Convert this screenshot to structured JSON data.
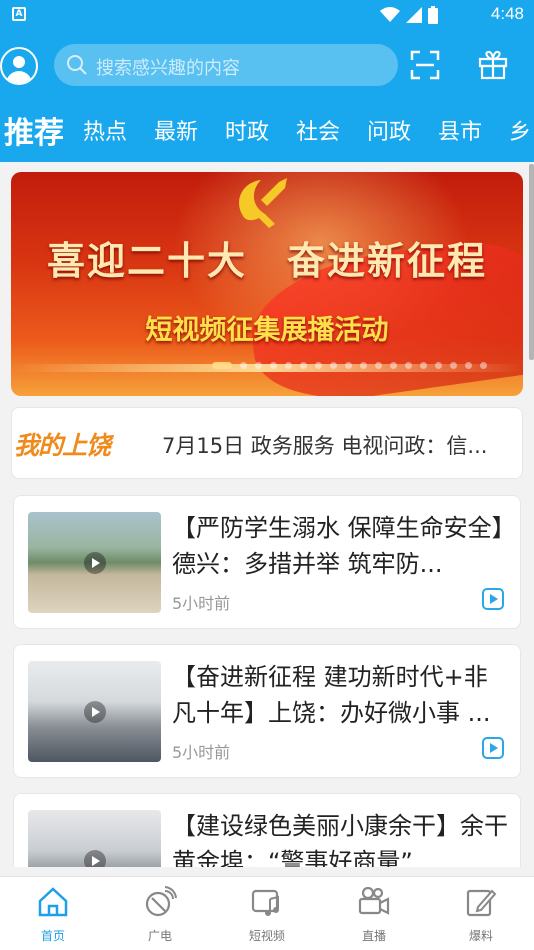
{
  "status_bar": {
    "time": "4:48",
    "notification_icon": "A"
  },
  "header": {
    "search_placeholder": "搜索感兴趣的内容",
    "tabs": [
      {
        "label": "推荐",
        "active": true
      },
      {
        "label": "热点"
      },
      {
        "label": "最新"
      },
      {
        "label": "时政"
      },
      {
        "label": "社会"
      },
      {
        "label": "问政"
      },
      {
        "label": "县市"
      },
      {
        "label": "乡"
      }
    ]
  },
  "banner": {
    "title": "喜迎二十大　奋进新征程",
    "subtitle": "短视频征集展播活动",
    "slide_count": 18,
    "active_slide": 1
  },
  "notice": {
    "logo": "我的上饶",
    "text": "7月15日  政务服务  电视问政：信..."
  },
  "articles": [
    {
      "title": "【严防学生溺水 保障生命安全】德兴：多措并举 筑牢防...",
      "time": "5小时前",
      "type": "video"
    },
    {
      "title": "【奋进新征程 建功新时代+非凡十年】上饶：办好微小事 ...",
      "time": "5小时前",
      "type": "video"
    },
    {
      "title": "【建设绿色美丽小康余干】余干黄金埠：“警事好商量”",
      "time": "",
      "type": "video"
    }
  ],
  "bottom_nav": [
    {
      "label": "首页",
      "icon": "home-icon",
      "active": true
    },
    {
      "label": "广电",
      "icon": "satellite-icon"
    },
    {
      "label": "短视频",
      "icon": "music-video-icon"
    },
    {
      "label": "直播",
      "icon": "camera-icon"
    },
    {
      "label": "爆料",
      "icon": "edit-icon"
    }
  ],
  "colors": {
    "brand": "#19a8ee",
    "active_nav": "#1ea0e8",
    "logo": "#f08a1c"
  }
}
